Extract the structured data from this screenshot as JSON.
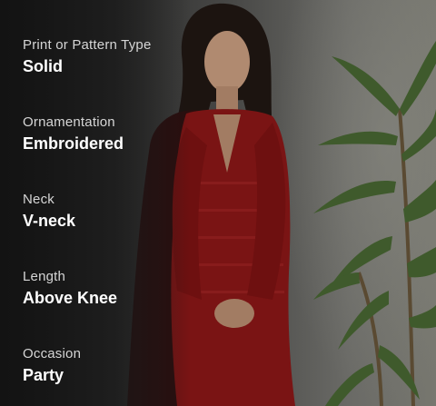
{
  "attributes": [
    {
      "label": "Print or Pattern Type",
      "value": "Solid"
    },
    {
      "label": "Ornamentation",
      "value": "Embroidered"
    },
    {
      "label": "Neck",
      "value": "V-neck"
    },
    {
      "label": "Length",
      "value": "Above Knee"
    },
    {
      "label": "Occasion",
      "value": "Party"
    }
  ],
  "colors": {
    "label": "#d6d6d6",
    "value": "#ffffff",
    "dress": "#7a1414",
    "leaf": "#3f5a2c"
  }
}
